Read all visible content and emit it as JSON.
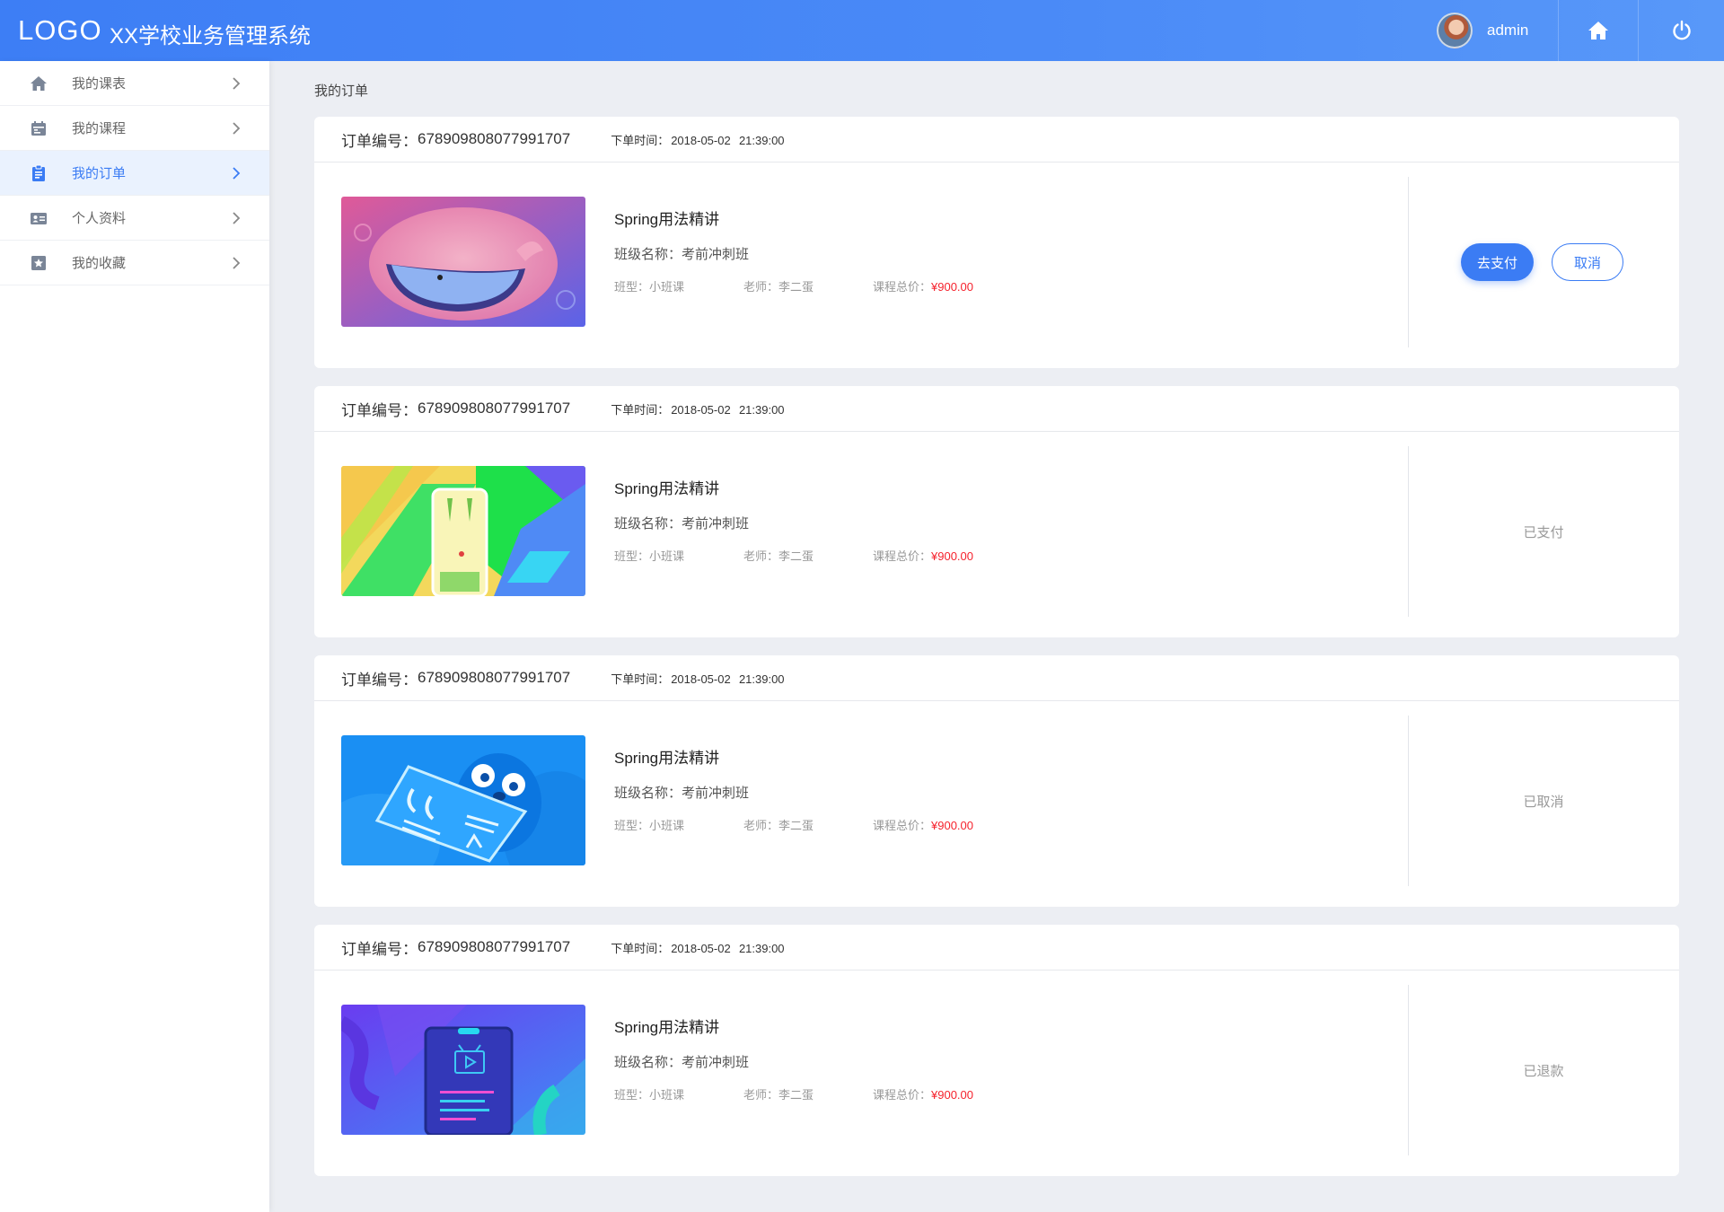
{
  "header": {
    "logo": "LOGO",
    "title": "XX学校业务管理系统",
    "username": "admin",
    "home_icon": "home-icon",
    "power_icon": "power-icon"
  },
  "sidebar": {
    "items": [
      {
        "label": "我的课表",
        "icon": "home-icon",
        "active": false
      },
      {
        "label": "我的课程",
        "icon": "calendar-icon",
        "active": false
      },
      {
        "label": "我的订单",
        "icon": "clipboard-icon",
        "active": true
      },
      {
        "label": "个人资料",
        "icon": "id-card-icon",
        "active": false
      },
      {
        "label": "我的收藏",
        "icon": "star-icon",
        "active": false
      }
    ]
  },
  "breadcrumb": "我的订单",
  "orders": [
    {
      "no_label": "订单编号：",
      "no": "678909808077991707",
      "time_label": "下单时间：",
      "date": "2018-05-02",
      "time": "21:39:00",
      "course_title": "Spring用法精讲",
      "class_name": "班级名称：考前冲刺班",
      "type": "班型：小班课",
      "teacher": "老师：李二蛋",
      "price_label": "课程总价：",
      "price": "¥900.00",
      "pay_label": "去支付",
      "cancel_label": "取消"
    },
    {
      "no_label": "订单编号：",
      "no": "678909808077991707",
      "time_label": "下单时间：",
      "date": "2018-05-02",
      "time": "21:39:00",
      "course_title": "Spring用法精讲",
      "class_name": "班级名称：考前冲刺班",
      "type": "班型：小班课",
      "teacher": "老师：李二蛋",
      "price_label": "课程总价：",
      "price": "¥900.00",
      "status": "已支付"
    },
    {
      "no_label": "订单编号：",
      "no": "678909808077991707",
      "time_label": "下单时间：",
      "date": "2018-05-02",
      "time": "21:39:00",
      "course_title": "Spring用法精讲",
      "class_name": "班级名称：考前冲刺班",
      "type": "班型：小班课",
      "teacher": "老师：李二蛋",
      "price_label": "课程总价：",
      "price": "¥900.00",
      "status": "已取消"
    },
    {
      "no_label": "订单编号：",
      "no": "678909808077991707",
      "time_label": "下单时间：",
      "date": "2018-05-02",
      "time": "21:39:00",
      "course_title": "Spring用法精讲",
      "class_name": "班级名称：考前冲刺班",
      "type": "班型：小班课",
      "teacher": "老师：李二蛋",
      "price_label": "课程总价：",
      "price": "¥900.00",
      "status": "已退款"
    }
  ],
  "colors": {
    "primary": "#3b7cf4",
    "price": "#f5222d",
    "header_start": "#3d7ef5",
    "header_end": "#5898f9"
  }
}
